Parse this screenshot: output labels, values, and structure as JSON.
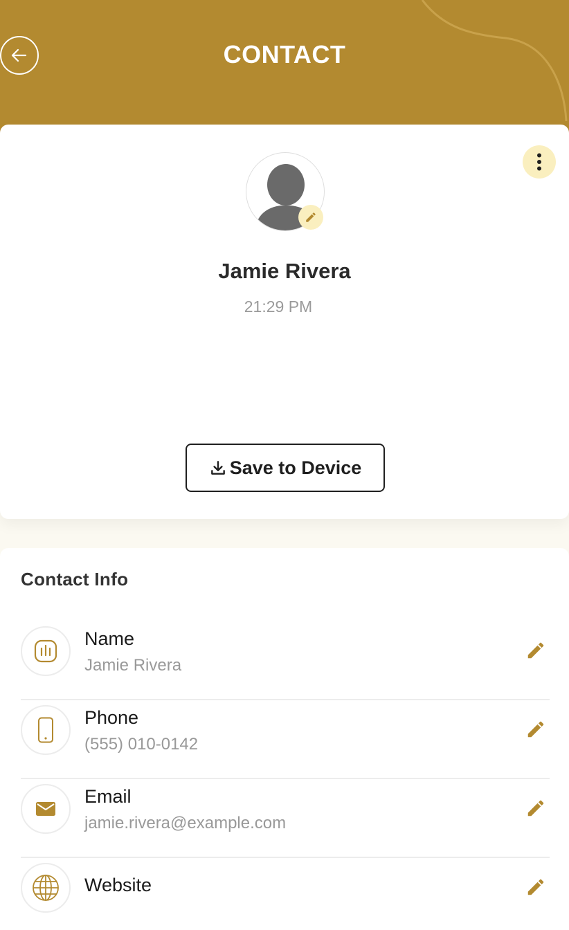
{
  "header": {
    "title": "CONTACT"
  },
  "profile": {
    "name": "Jamie Rivera",
    "time": "21:29 PM",
    "save_label": "Save to Device"
  },
  "contact_info": {
    "title": "Contact Info",
    "rows": [
      {
        "label": "Name",
        "value": "Jamie Rivera",
        "icon": "chart-badge-icon"
      },
      {
        "label": "Phone",
        "value": "(555) 010-0142",
        "icon": "phone-icon"
      },
      {
        "label": "Email",
        "value": "jamie.rivera@example.com",
        "icon": "mail-icon"
      },
      {
        "label": "Website",
        "value": "",
        "icon": "globe-icon"
      }
    ]
  },
  "colors": {
    "brand": "#b38a30",
    "accent_soft": "#faefbf",
    "text_dark": "#2a2a2a",
    "text_muted": "#999999"
  }
}
